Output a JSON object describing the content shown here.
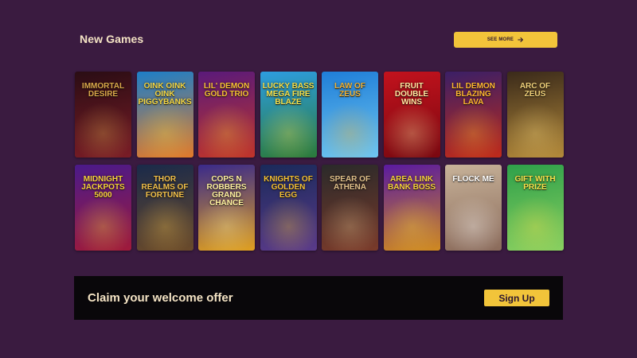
{
  "section": {
    "title": "New Games",
    "see_more_label": "SEE MORE"
  },
  "games": [
    {
      "title": "IMMORTAL DESIRE",
      "bg": [
        "#2a0d14",
        "#7a1c26"
      ],
      "accent": "#d9a94a"
    },
    {
      "title": "OINK OINK OINK PIGGYBANKS",
      "bg": [
        "#1d7ec8",
        "#e27a2a"
      ],
      "accent": "#f5d742"
    },
    {
      "title": "LIL' DEMON GOLD TRIO",
      "bg": [
        "#5a1a7a",
        "#c0342a"
      ],
      "accent": "#f6c233"
    },
    {
      "title": "LUCKY BASS MEGA FIRE BLAZE",
      "bg": [
        "#2d9de0",
        "#2b7a3a"
      ],
      "accent": "#f6e04a"
    },
    {
      "title": "LAW OF ZEUS",
      "bg": [
        "#1f7ed8",
        "#6fc6f0"
      ],
      "accent": "#f2b233"
    },
    {
      "title": "FRUIT DOUBLE WINS",
      "bg": [
        "#c2121d",
        "#7a0810"
      ],
      "accent": "#ffe7a0"
    },
    {
      "title": "LIL DEMON BLAZING LAVA",
      "bg": [
        "#3b1f66",
        "#c02a1a"
      ],
      "accent": "#ffb92e"
    },
    {
      "title": "ARC OF ZEUS",
      "bg": [
        "#3a2a1a",
        "#b48a3a"
      ],
      "accent": "#f1d27a"
    },
    {
      "title": "MIDNIGHT JACKPOTS 5000",
      "bg": [
        "#4a1a8a",
        "#a01a3a"
      ],
      "accent": "#f6d23a"
    },
    {
      "title": "THOR REALMS OF FORTUNE",
      "bg": [
        "#1a2a4a",
        "#6a4a2a"
      ],
      "accent": "#f2c04a"
    },
    {
      "title": "COPS N ROBBERS GRAND CHANCE",
      "bg": [
        "#3a2a8a",
        "#e0a020"
      ],
      "accent": "#fff2a0"
    },
    {
      "title": "KNIGHTS OF GOLDEN EGG",
      "bg": [
        "#1a2a5a",
        "#5a3a8a"
      ],
      "accent": "#f6c233"
    },
    {
      "title": "SPEAR OF ATHENA",
      "bg": [
        "#2a2a2a",
        "#7a3a2a"
      ],
      "accent": "#e0c08a"
    },
    {
      "title": "AREA LINK BANK BOSS",
      "bg": [
        "#5a1aa0",
        "#d08a20"
      ],
      "accent": "#f6d23a"
    },
    {
      "title": "FLOCK ME",
      "bg": [
        "#c7b299",
        "#8a6a5a"
      ],
      "accent": "#ffffff"
    },
    {
      "title": "GIFT WITH PRIZE",
      "bg": [
        "#2ea04a",
        "#8ad060"
      ],
      "accent": "#f6e04a"
    }
  ],
  "banner": {
    "text": "Claim your welcome offer",
    "button_label": "Sign Up"
  }
}
